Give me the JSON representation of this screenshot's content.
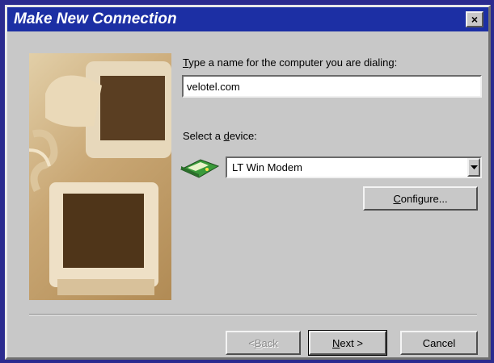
{
  "window": {
    "title": "Make New Connection",
    "close_label": "×"
  },
  "form": {
    "name_label_prefix": "T",
    "name_label_rest": "ype a name for the computer you are dialing:",
    "name_value": "velotel.com",
    "device_label_prefix": "Select a ",
    "device_label_mnemonic": "d",
    "device_label_rest": "evice:",
    "device_value": "LT Win Modem",
    "device_icon": "modem-icon"
  },
  "buttons": {
    "configure_mnemonic": "C",
    "configure_rest": "onfigure...",
    "back_prefix": "< ",
    "back_mnemonic": "B",
    "back_rest": "ack",
    "next_mnemonic": "N",
    "next_rest": "ext >",
    "cancel": "Cancel"
  },
  "colors": {
    "titlebar": "#1c2fa4",
    "face": "#c8c8c8",
    "desktop": "#2b2b8f"
  }
}
